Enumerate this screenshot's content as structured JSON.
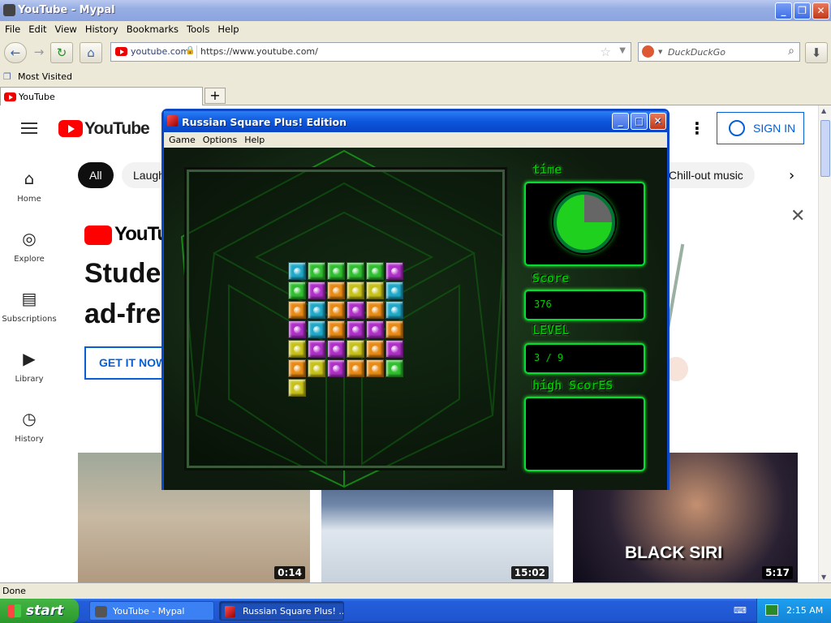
{
  "browser": {
    "title": "YouTube - Mypal",
    "menu": [
      "File",
      "Edit",
      "View",
      "History",
      "Bookmarks",
      "Tools",
      "Help"
    ],
    "site_identity": "youtube.com",
    "url": "https://www.youtube.com/",
    "search_placeholder": "DuckDuckGo",
    "bookmark": "Most Visited",
    "tab_label": "YouTube",
    "new_tab": "+",
    "status": "Done"
  },
  "youtube": {
    "logo": "YouTube",
    "sign_in": "SIGN IN",
    "sidebar": [
      {
        "icon": "home-icon",
        "glyph": "⌂",
        "label": "Home"
      },
      {
        "icon": "explore-icon",
        "glyph": "◎",
        "label": "Explore"
      },
      {
        "icon": "subscriptions-icon",
        "glyph": "▤",
        "label": "Subscriptions"
      },
      {
        "icon": "library-icon",
        "glyph": "▶",
        "label": "Library"
      },
      {
        "icon": "history-icon",
        "glyph": "◷",
        "label": "History"
      }
    ],
    "chips": [
      "All",
      "Laugh",
      "Chill-out music"
    ],
    "promo": {
      "logo": "YouTube",
      "line1": "Studer",
      "line2": "ad-fre",
      "cta": "GET IT NOW"
    },
    "thumbnails": [
      {
        "duration": "0:14"
      },
      {
        "duration": "15:02"
      },
      {
        "duration": "5:17",
        "overlay": "BLACK SIRI"
      }
    ]
  },
  "game": {
    "title": "Russian Square Plus! Edition",
    "menu": [
      "Game",
      "Options",
      "Help"
    ],
    "labels": {
      "time": "time",
      "score": "Score",
      "level": "LEVEL",
      "high_scores": "high ScorES"
    },
    "score": "376",
    "level": "3 / 9",
    "time_elapsed_fraction": 0.25,
    "block_colors": {
      "c": "#1fa9c9",
      "g": "#2fbf2f",
      "p": "#b02fc9",
      "o": "#e88a14",
      "y": "#c7c21a",
      "r": "#d4302a"
    },
    "grid": [
      "cggggp",
      "gpoyyc",
      "ocopoc",
      "pcoppo",
      "yppyop",
      "oypoog",
      "y"
    ]
  },
  "taskbar": {
    "start": "start",
    "tasks": [
      "YouTube - Mypal",
      "Russian Square Plus! ..."
    ],
    "clock": "2:15 AM"
  }
}
